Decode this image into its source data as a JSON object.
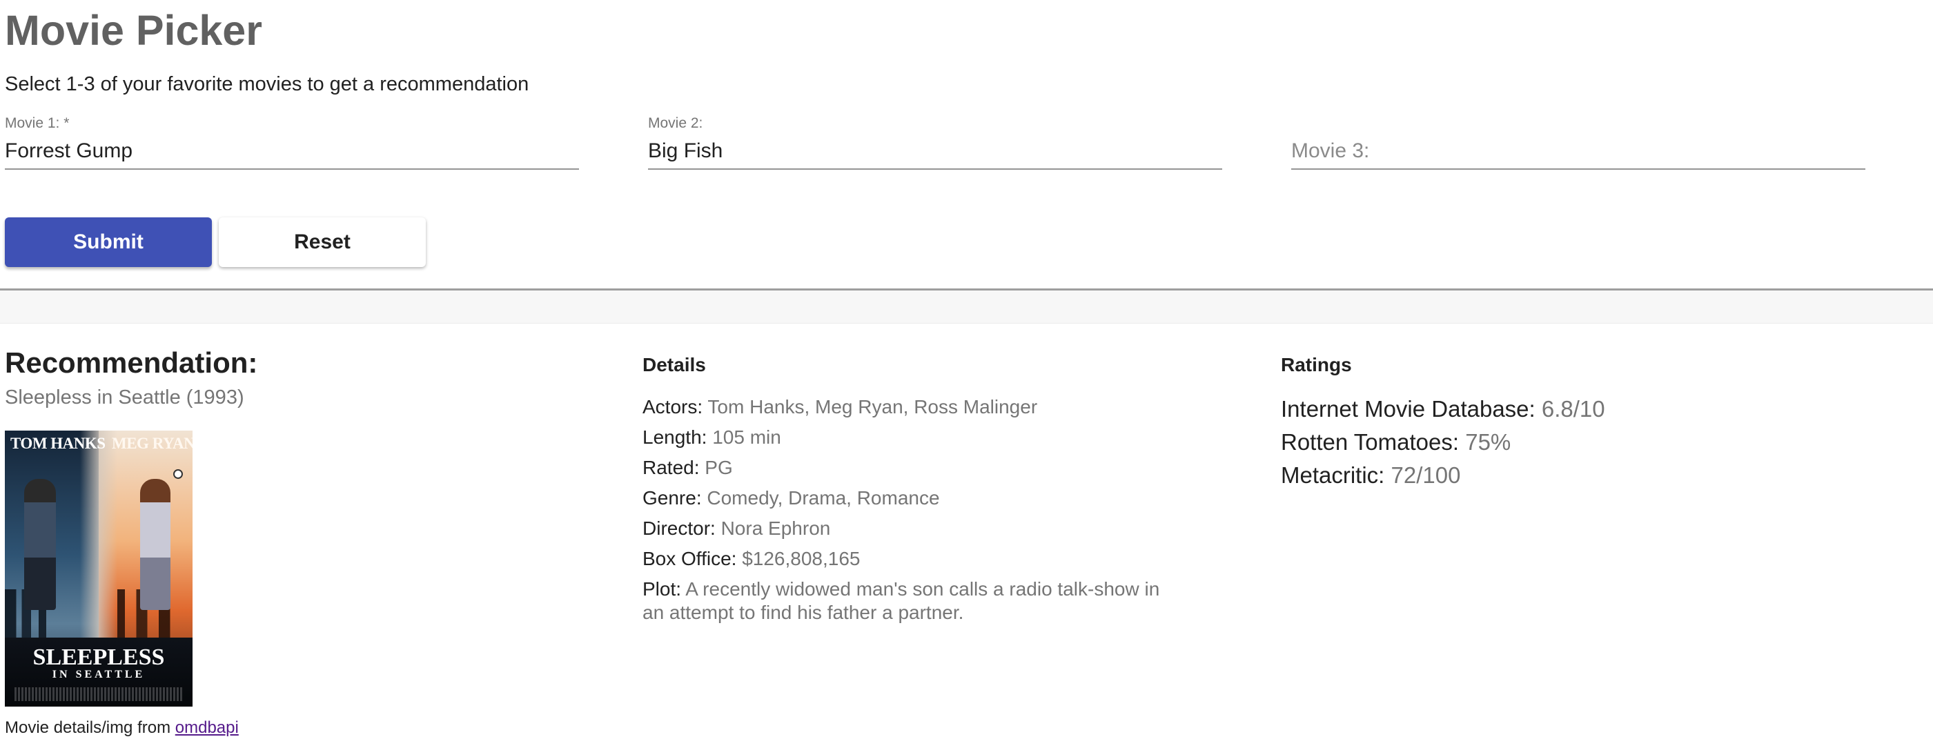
{
  "header": {
    "title": "Movie Picker",
    "subtitle": "Select 1-3 of your favorite movies to get a recommendation"
  },
  "form": {
    "movie1": {
      "label": "Movie 1:  *",
      "value": "Forrest Gump",
      "placeholder": ""
    },
    "movie2": {
      "label": "Movie 2:",
      "value": "Big Fish",
      "placeholder": ""
    },
    "movie3": {
      "label": "",
      "value": "",
      "placeholder": "Movie 3:"
    },
    "submit_label": "Submit",
    "reset_label": "Reset"
  },
  "recommendation": {
    "heading": "Recommendation:",
    "movie": "Sleepless in Seattle (1993)",
    "poster": {
      "name_left": "TOM HANKS",
      "name_right": "MEG RYAN",
      "title_line1": "SLEEPLESS",
      "title_line2": "IN SEATTLE"
    },
    "credit_prefix": "Movie details/img from ",
    "credit_link": "omdbapi"
  },
  "details": {
    "heading": "Details",
    "rows": [
      {
        "label": "Actors:",
        "value": "Tom Hanks, Meg Ryan, Ross Malinger"
      },
      {
        "label": "Length:",
        "value": "105 min"
      },
      {
        "label": "Rated:",
        "value": "PG"
      },
      {
        "label": "Genre:",
        "value": "Comedy, Drama, Romance"
      },
      {
        "label": "Director:",
        "value": "Nora Ephron"
      },
      {
        "label": "Box Office:",
        "value": "$126,808,165"
      },
      {
        "label": "Plot:",
        "value": "A recently widowed man's son calls a radio talk-show in an attempt to find his father a partner."
      }
    ]
  },
  "ratings": {
    "heading": "Ratings",
    "rows": [
      {
        "label": "Internet Movie Database:",
        "value": "6.8/10"
      },
      {
        "label": "Rotten Tomatoes:",
        "value": "75%"
      },
      {
        "label": "Metacritic:",
        "value": "72/100"
      }
    ]
  },
  "colors": {
    "primary": "#3f51b5",
    "title_gray": "#616161",
    "secondary_text": "#757575",
    "link": "#551a8b"
  }
}
